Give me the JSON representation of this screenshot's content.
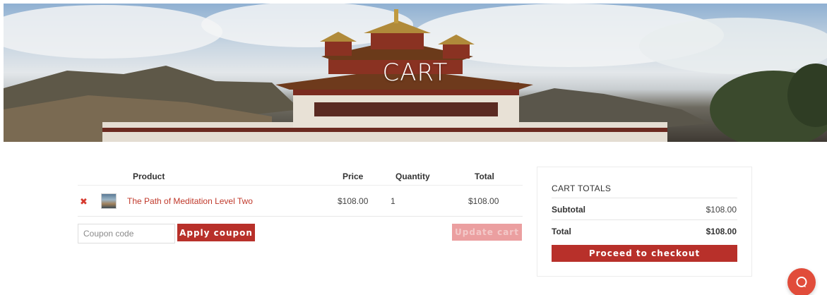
{
  "hero": {
    "title": "CART"
  },
  "cart": {
    "columns": {
      "product": "Product",
      "price": "Price",
      "quantity": "Quantity",
      "total": "Total"
    },
    "items": [
      {
        "name": "The Path of Meditation Level Two",
        "price": "$108.00",
        "quantity": "1",
        "total": "$108.00"
      }
    ],
    "coupon_placeholder": "Coupon code",
    "apply_coupon_label": "Apply coupon",
    "update_cart_label": "Update cart"
  },
  "totals": {
    "title": "CART TOTALS",
    "subtotal_label": "Subtotal",
    "subtotal_value": "$108.00",
    "total_label": "Total",
    "total_value": "$108.00",
    "checkout_label": "Proceed to checkout"
  },
  "icons": {
    "remove": "close-icon",
    "chat": "chat-icon"
  },
  "colors": {
    "accent": "#b8302a",
    "link": "#c0392b",
    "remove": "#d63a2f",
    "chat": "#e14c3a",
    "update_disabled": "#eb9fa0"
  }
}
